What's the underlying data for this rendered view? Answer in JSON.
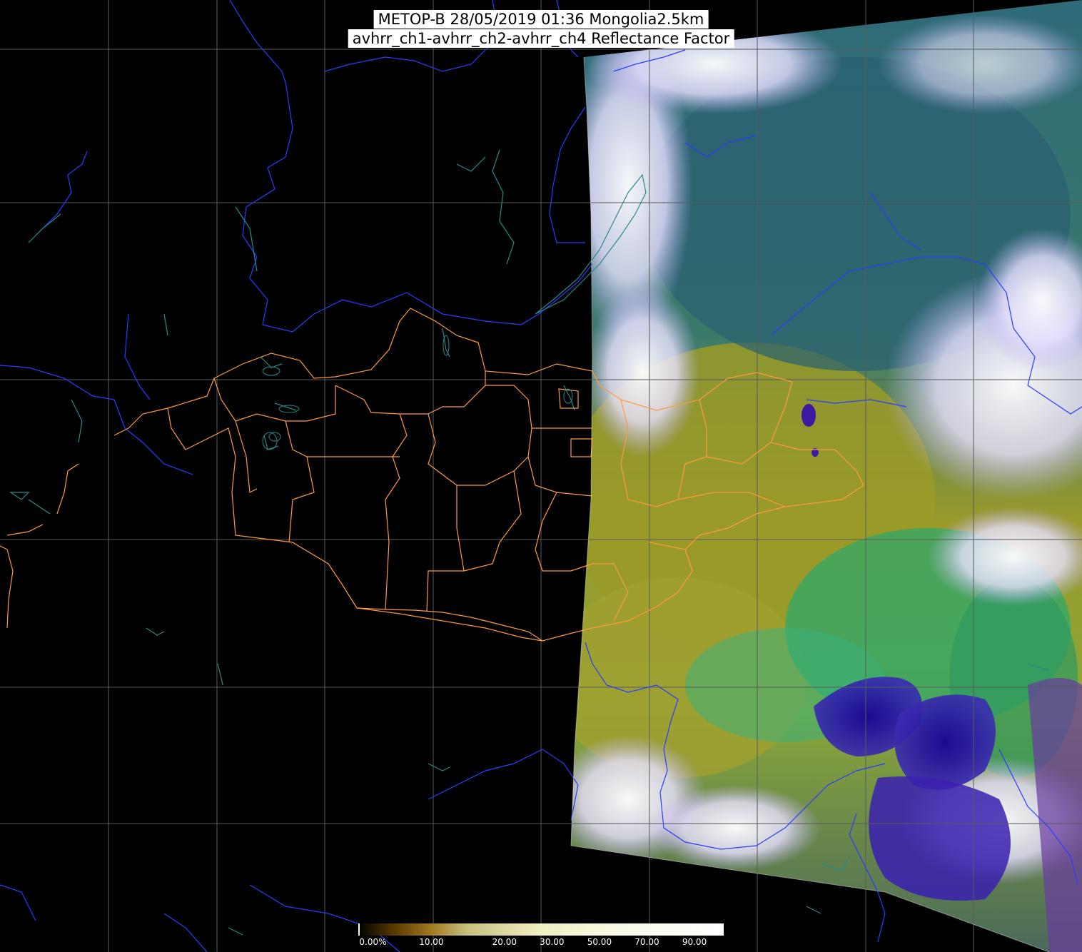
{
  "title": {
    "line1": "METOP-B 28/05/2019 01:36 Mongolia2.5km",
    "line2": "avhrr_ch1-avhrr_ch2-avhrr_ch4 Reflectance Factor"
  },
  "colorbar": {
    "ticks": [
      {
        "label": "0.00%",
        "value": 0
      },
      {
        "label": "10.00",
        "value": 10
      },
      {
        "label": "20.00",
        "value": 20
      },
      {
        "label": "30.00",
        "value": 30
      },
      {
        "label": "50.00",
        "value": 50
      },
      {
        "label": "70.00",
        "value": 70
      },
      {
        "label": "90.00",
        "value": 90
      }
    ],
    "stops": [
      {
        "value": 0,
        "color": "#000000"
      },
      {
        "value": 10,
        "color": "#5a3a00"
      },
      {
        "value": 20,
        "color": "#a07a20"
      },
      {
        "value": 30,
        "color": "#c8c080"
      },
      {
        "value": 50,
        "color": "#f0f0c0"
      },
      {
        "value": 70,
        "color": "#fafae6"
      },
      {
        "value": 100,
        "color": "#ffffff"
      }
    ]
  },
  "colors": {
    "background": "#000000",
    "graticule": "#5a5a5a",
    "coastline": "#2a3cff",
    "rivers": "#2a8a8a",
    "admin_borders": "#ff9a40",
    "cloud": "#f2ecff",
    "land_yellow": "#9a9a2a",
    "land_green": "#2fa86a",
    "forest_teal": "#2f6e7a",
    "sea": "#2a1aa0"
  }
}
